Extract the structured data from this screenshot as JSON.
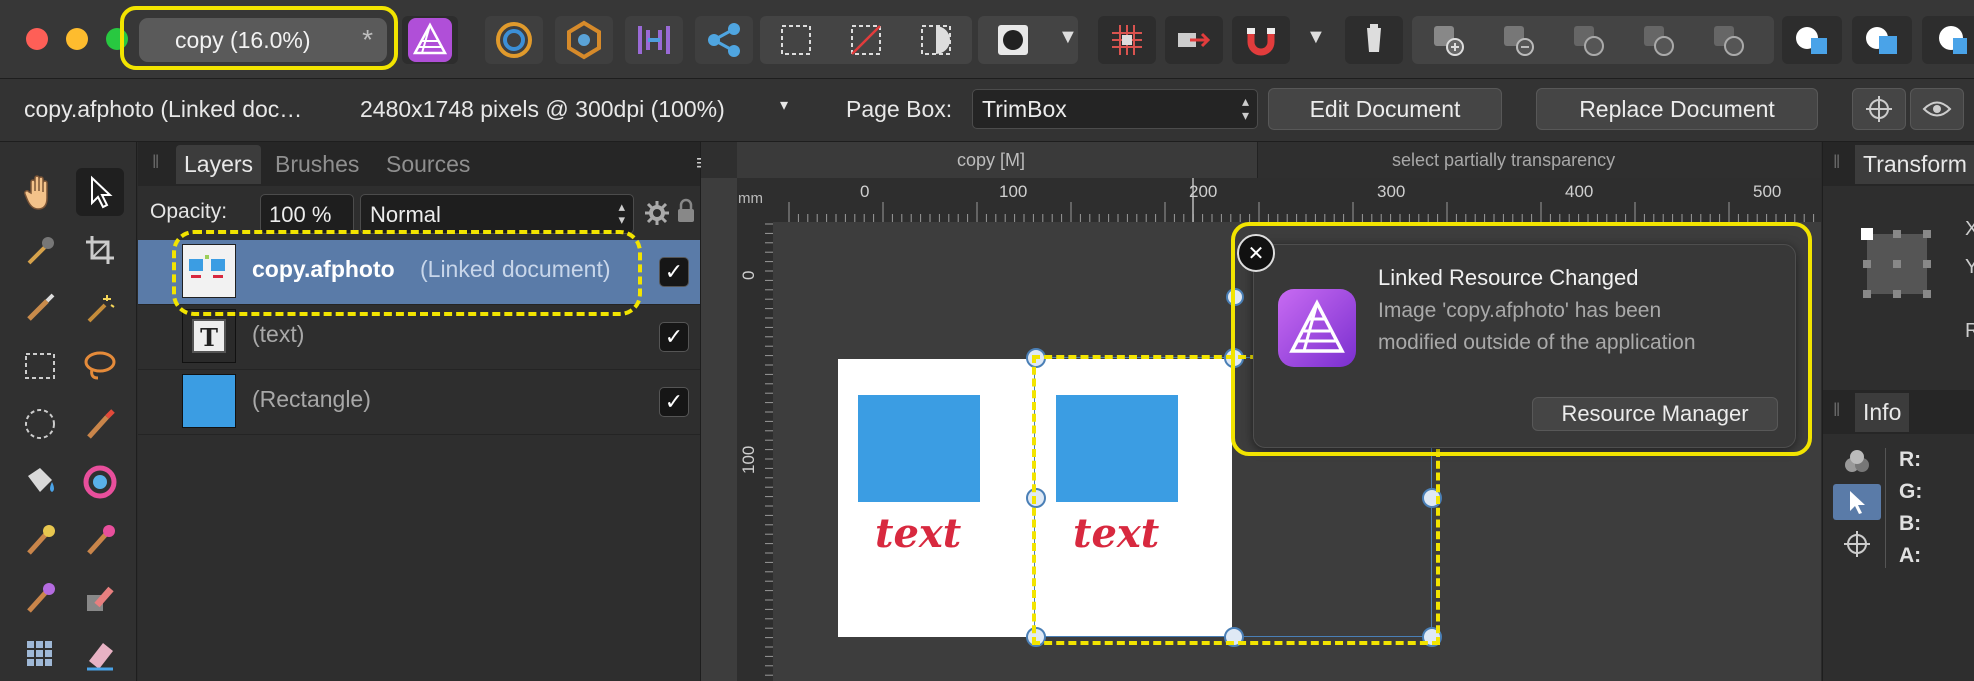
{
  "toolbar": {
    "doc_tab_label": "copy (16.0%)",
    "doc_tab_modified": "*"
  },
  "context": {
    "doc_name": "copy.afphoto (Linked doc…",
    "doc_info": "2480x1748 pixels @ 300dpi (100%)",
    "dropdown_arrow": "▾",
    "page_box_label": "Page Box:",
    "page_box_value": "TrimBox",
    "edit_document": "Edit Document",
    "replace_document": "Replace Document"
  },
  "layers_panel": {
    "tabs": [
      "Layers",
      "Brushes",
      "Sources"
    ],
    "opacity_label": "Opacity:",
    "opacity_value": "100 %",
    "blend_mode": "Normal",
    "layers": [
      {
        "name": "copy.afphoto",
        "type": "(Linked document)",
        "visible": true,
        "selected": true
      },
      {
        "name": "(text)",
        "visible": true
      },
      {
        "name": "(Rectangle)",
        "visible": true
      }
    ],
    "check": "✓"
  },
  "canvas": {
    "view_tabs": [
      "copy [M]",
      "select partially transparency"
    ],
    "ruler_unit": "mm",
    "ruler_h_labels": [
      "0",
      "100",
      "200",
      "300",
      "400",
      "500"
    ],
    "ruler_v_labels": [
      "0",
      "100"
    ],
    "artwork_text": "text"
  },
  "notification": {
    "title": "Linked Resource Changed",
    "message_line1": "Image 'copy.afphoto' has been",
    "message_line2": "modified outside of the application",
    "button": "Resource Manager",
    "close": "✕"
  },
  "right_panel": {
    "transform_title": "Transform",
    "transform_labels": [
      "X",
      "Y",
      "R"
    ],
    "info_title": "Info",
    "channels": [
      "R:",
      "G:",
      "B:",
      "A:"
    ]
  },
  "colors": {
    "accent_highlight": "#f2e400",
    "selection_blue": "#5a7ba8",
    "artwork_blue": "#3b9de3",
    "artwork_text_red": "#d8293f",
    "app_icon": "#b452e0"
  }
}
